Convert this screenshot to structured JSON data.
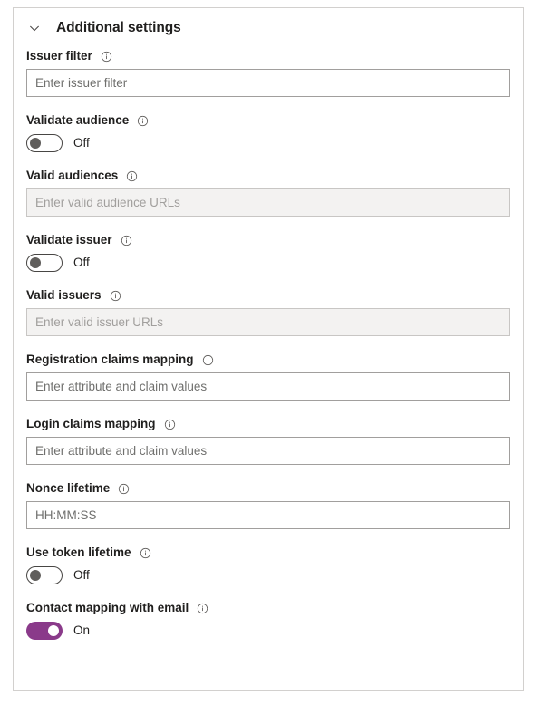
{
  "panel": {
    "title": "Additional settings",
    "expanded": true,
    "chevron_icon": "chevron-down-icon",
    "info_icon": "info-icon"
  },
  "colors": {
    "toggle_on_fill": "#8a3a8a",
    "toggle_off_border": "#484644",
    "toggle_off_knob": "#605e5c",
    "panel_border": "#d2d0ce",
    "input_border": "#a19f9d",
    "input_disabled_bg": "#f3f2f1",
    "text_primary": "#201f1e",
    "placeholder": "#70706e",
    "placeholder_disabled": "#a19f9d"
  },
  "fields": [
    {
      "id": "issuer-filter",
      "label": "Issuer filter",
      "type": "text",
      "value": "",
      "placeholder": "Enter issuer filter",
      "disabled": false,
      "has_info": true
    },
    {
      "id": "validate-audience",
      "label": "Validate audience",
      "type": "toggle",
      "state": "Off",
      "on": false,
      "has_info": true
    },
    {
      "id": "valid-audiences",
      "label": "Valid audiences",
      "type": "text",
      "value": "",
      "placeholder": "Enter valid audience URLs",
      "disabled": true,
      "has_info": true
    },
    {
      "id": "validate-issuer",
      "label": "Validate issuer",
      "type": "toggle",
      "state": "Off",
      "on": false,
      "has_info": true
    },
    {
      "id": "valid-issuers",
      "label": "Valid issuers",
      "type": "text",
      "value": "",
      "placeholder": "Enter valid issuer URLs",
      "disabled": true,
      "has_info": true
    },
    {
      "id": "registration-claims-mapping",
      "label": "Registration claims mapping",
      "type": "text",
      "value": "",
      "placeholder": "Enter attribute and claim values",
      "disabled": false,
      "has_info": true
    },
    {
      "id": "login-claims-mapping",
      "label": "Login claims mapping",
      "type": "text",
      "value": "",
      "placeholder": "Enter attribute and claim values",
      "disabled": false,
      "has_info": true
    },
    {
      "id": "nonce-lifetime",
      "label": "Nonce lifetime",
      "type": "text",
      "value": "",
      "placeholder": "HH:MM:SS",
      "disabled": false,
      "has_info": true
    },
    {
      "id": "use-token-lifetime",
      "label": "Use token lifetime",
      "type": "toggle",
      "state": "Off",
      "on": false,
      "has_info": true
    },
    {
      "id": "contact-mapping-with-email",
      "label": "Contact mapping with email",
      "type": "toggle",
      "state": "On",
      "on": true,
      "has_info": true
    }
  ]
}
